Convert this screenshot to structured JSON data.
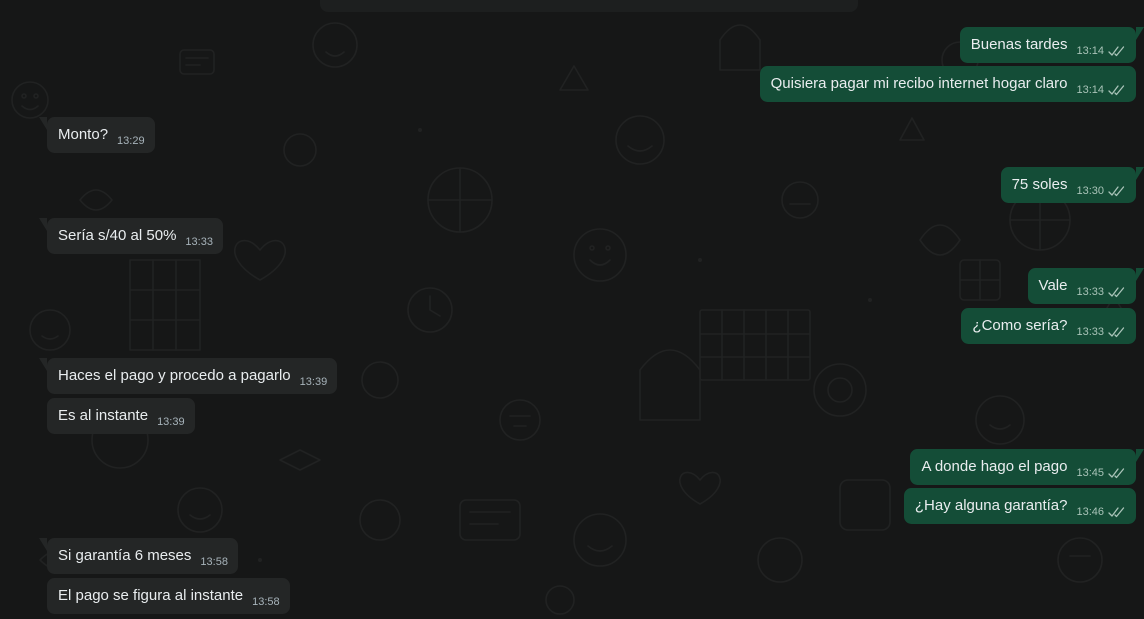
{
  "chat": {
    "messages": [
      {
        "dir": "out",
        "text": "Buenas tardes",
        "time": "13:14",
        "first": true
      },
      {
        "dir": "out",
        "text": "Quisiera pagar mi recibo internet hogar claro",
        "time": "13:14",
        "first": false
      },
      {
        "dir": "in",
        "text": "Monto?",
        "time": "13:29",
        "first": true
      },
      {
        "dir": "out",
        "text": "75 soles",
        "time": "13:30",
        "first": true
      },
      {
        "dir": "in",
        "text": "Sería s/40 al 50%",
        "time": "13:33",
        "first": true
      },
      {
        "dir": "out",
        "text": "Vale",
        "time": "13:33",
        "first": true
      },
      {
        "dir": "out",
        "text": "¿Como sería?",
        "time": "13:33",
        "first": false
      },
      {
        "dir": "in",
        "text": "Haces el pago y procedo a pagarlo",
        "time": "13:39",
        "first": true
      },
      {
        "dir": "in",
        "text": "Es al instante",
        "time": "13:39",
        "first": false
      },
      {
        "dir": "out",
        "text": "A donde hago el pago",
        "time": "13:45",
        "first": true
      },
      {
        "dir": "out",
        "text": "¿Hay alguna garantía?",
        "time": "13:46",
        "first": false
      },
      {
        "dir": "in",
        "text": "Si garantía 6 meses",
        "time": "13:58",
        "first": true
      },
      {
        "dir": "in",
        "text": "El pago se figura al instante",
        "time": "13:58",
        "first": false
      }
    ]
  },
  "colors": {
    "background": "#161717",
    "incoming_bubble": "#242626",
    "outgoing_bubble": "#144d37",
    "text": "#e9edef",
    "read_ticks": "#a9c3b8"
  },
  "icons": {
    "read_receipt": "double-check-icon"
  }
}
